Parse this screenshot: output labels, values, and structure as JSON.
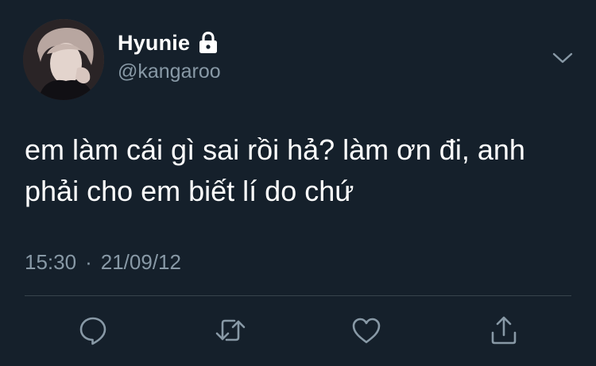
{
  "tweet": {
    "author": {
      "display_name": "Hyunie",
      "handle": "@kangaroo",
      "protected_icon": "lock-icon",
      "avatar": "profile-photo"
    },
    "menu_icon": "chevron-down-icon",
    "text": "em làm cái gì sai rồi hả? làm ơn đi, anh phải cho em biết lí do chứ",
    "time": "15:30",
    "separator": "·",
    "date": "21/09/12",
    "actions": [
      {
        "name": "reply",
        "icon": "comment-icon"
      },
      {
        "name": "retweet",
        "icon": "retweet-icon"
      },
      {
        "name": "like",
        "icon": "heart-icon"
      },
      {
        "name": "share",
        "icon": "share-icon"
      }
    ]
  },
  "colors": {
    "background": "#15202b",
    "text_primary": "#ffffff",
    "text_secondary": "#8899a6",
    "divider": "#38444d"
  }
}
